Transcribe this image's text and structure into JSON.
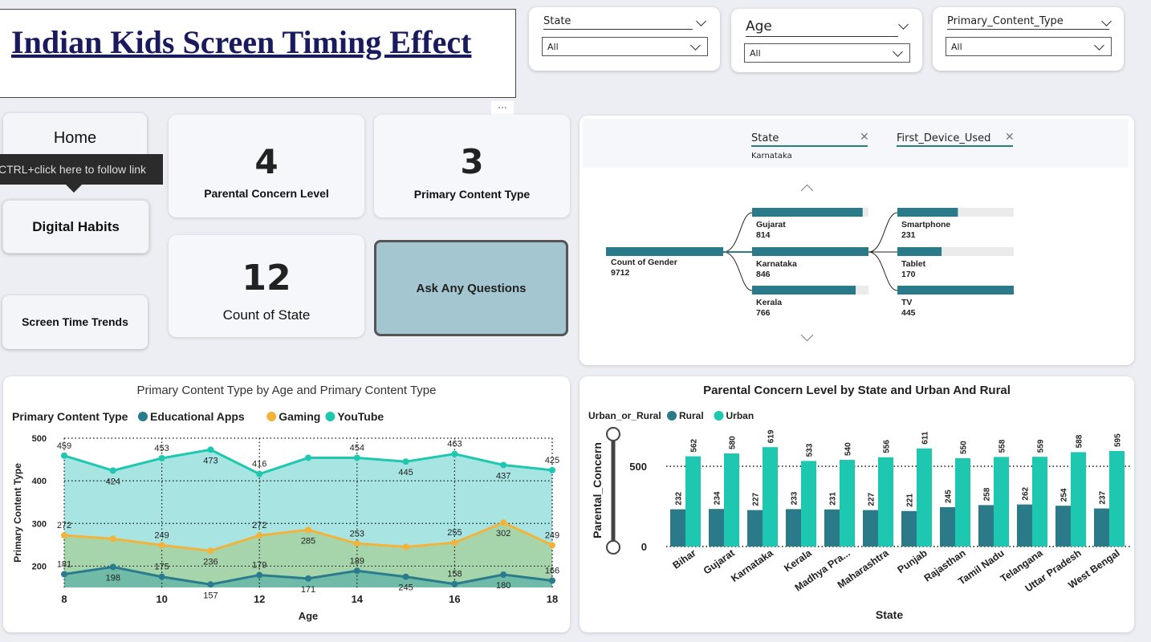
{
  "title": "Indian Kids Screen Timing Effect",
  "slicers": [
    {
      "label": "State",
      "value": "All"
    },
    {
      "label": "Age",
      "value": "All"
    },
    {
      "label": "Primary_Content_Type",
      "value": "All"
    }
  ],
  "more_options": "...",
  "nav": {
    "home": "Home",
    "tooltip": "CTRL+click here to follow link",
    "digital_habits": "Digital Habits",
    "screen_time_trends": "Screen Time Trends"
  },
  "kpis": {
    "parental_concern": {
      "value": "4",
      "label": "Parental Concern Level"
    },
    "primary_content": {
      "value": "3",
      "label": "Primary Content Type"
    },
    "count_state": {
      "value": "12",
      "label": "Count of State"
    },
    "ask_button": "Ask Any Questions"
  },
  "decomp_tree": {
    "filters": [
      {
        "label": "State",
        "value": "Karnataka"
      },
      {
        "label": "First_Device_Used",
        "value": ""
      }
    ],
    "root": {
      "label": "Count of Gender",
      "value": "9712"
    },
    "level1": [
      {
        "label": "Gujarat",
        "value": "814",
        "fraction": 0.95
      },
      {
        "label": "Karnataka",
        "value": "846",
        "fraction": 1.0
      },
      {
        "label": "Kerala",
        "value": "766",
        "fraction": 0.89
      }
    ],
    "level2": [
      {
        "label": "Smartphone",
        "value": "231",
        "fraction": 0.52
      },
      {
        "label": "Tablet",
        "value": "170",
        "fraction": 0.38
      },
      {
        "label": "TV",
        "value": "445",
        "fraction": 1.0
      }
    ],
    "colors": {
      "bar": "#2b7a8a",
      "track": "#ebebeb"
    }
  },
  "charts": {
    "area": {
      "title": "Primary Content Type by Age and Primary Content Type",
      "legend_title": "Primary Content Type"
    },
    "bar": {
      "title": "Parental Concern Level by State and Urban And Rural",
      "legend_title": "Urban_or_Rural"
    }
  },
  "chart_data": [
    {
      "type": "area",
      "title": "Primary Content Type by Age and Primary Content Type",
      "xlabel": "Age",
      "ylabel": "Primary Content Type",
      "x": [
        8,
        9,
        10,
        11,
        12,
        13,
        14,
        15,
        16,
        17,
        18
      ],
      "x_ticks": [
        "8",
        "10",
        "12",
        "14",
        "16",
        "18"
      ],
      "y_ticks": [
        "200",
        "300",
        "400",
        "500"
      ],
      "ylim": [
        150,
        500
      ],
      "grid": true,
      "legend_position": "top-left",
      "series": [
        {
          "name": "Educational Apps",
          "color": "#2a7c8c",
          "values": [
            181,
            198,
            175,
            157,
            179,
            171,
            189,
            175,
            158,
            180,
            166
          ],
          "labels": [
            "181",
            "198",
            "175",
            "157",
            "179",
            "171",
            "189",
            "245",
            "158",
            "180",
            "166"
          ]
        },
        {
          "name": "Gaming",
          "color": "#f2b33d",
          "values": [
            272,
            264,
            249,
            236,
            272,
            285,
            253,
            245,
            255,
            302,
            249
          ],
          "labels": [
            "272",
            "",
            "249",
            "236",
            "272",
            "285",
            "253",
            "",
            "255",
            "302",
            "249"
          ]
        },
        {
          "name": "YouTube",
          "color": "#1dc7b0",
          "values": [
            459,
            424,
            453,
            473,
            416,
            454,
            454,
            445,
            463,
            437,
            425
          ],
          "labels": [
            "459",
            "424",
            "453",
            "473",
            "416",
            "",
            "454",
            "445",
            "463",
            "437",
            "425"
          ]
        }
      ]
    },
    {
      "type": "bar",
      "title": "Parental Concern Level by State and Urban And Rural",
      "xlabel": "State",
      "ylabel": "Parental_Concern",
      "categories": [
        "Bihar",
        "Gujarat",
        "Karnataka",
        "Kerala",
        "Madhya Pra...",
        "Maharashtra",
        "Punjab",
        "Rajasthan",
        "Tamil Nadu",
        "Telangana",
        "Uttar Pradesh",
        "West Bengal"
      ],
      "y_ticks": [
        "0",
        "500"
      ],
      "ylim": [
        0,
        700
      ],
      "legend_position": "top-left",
      "series": [
        {
          "name": "Rural",
          "color": "#2b7a8a",
          "values": [
            232,
            234,
            227,
            233,
            231,
            227,
            221,
            245,
            258,
            262,
            254,
            237
          ],
          "labels": [
            "232",
            "234",
            "227",
            "233",
            "231",
            "227",
            "221",
            "245",
            "258",
            "262",
            "254",
            "237"
          ]
        },
        {
          "name": "Urban",
          "color": "#1dc7b0",
          "values": [
            562,
            580,
            619,
            533,
            540,
            556,
            611,
            550,
            558,
            559,
            588,
            595
          ],
          "labels": [
            "562",
            "580",
            "619",
            "533",
            "540",
            "556",
            "611",
            "550",
            "558",
            "559",
            "588",
            "595"
          ]
        }
      ]
    }
  ]
}
